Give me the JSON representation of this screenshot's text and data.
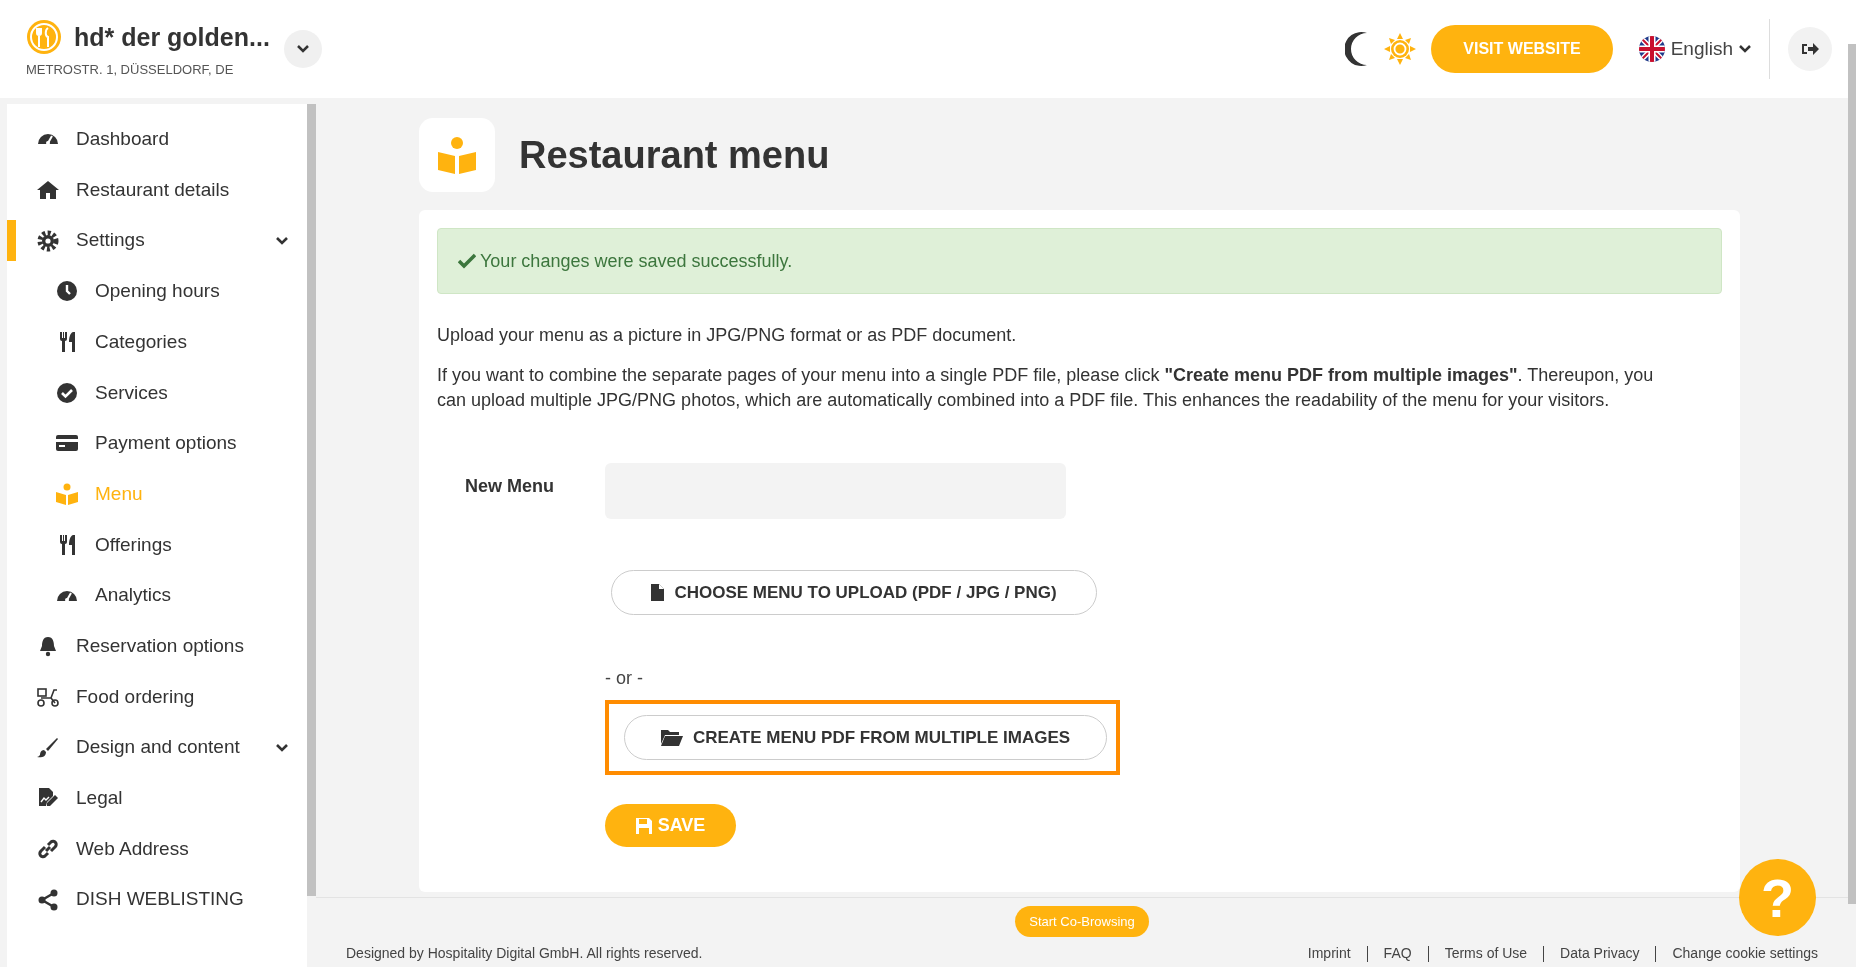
{
  "header": {
    "restaurant_name": "hd* der golden...",
    "address": "METROSTR. 1, DÜSSELDORF, DE",
    "visit_button": "VISIT WEBSITE",
    "language": "English",
    "light_mode": true
  },
  "sidebar": {
    "items": [
      {
        "label": "Dashboard",
        "selected": false
      },
      {
        "label": "Restaurant details",
        "selected": false
      },
      {
        "label": "Settings",
        "selected": false,
        "expanded": true,
        "children": [
          {
            "label": "Opening hours",
            "selected": false
          },
          {
            "label": "Categories",
            "selected": false
          },
          {
            "label": "Services",
            "selected": false
          },
          {
            "label": "Payment options",
            "selected": false
          },
          {
            "label": "Menu",
            "selected": true
          },
          {
            "label": "Offerings",
            "selected": false
          },
          {
            "label": "Analytics",
            "selected": false
          }
        ]
      },
      {
        "label": "Reservation options",
        "selected": false
      },
      {
        "label": "Food ordering",
        "selected": false
      },
      {
        "label": "Design and content",
        "selected": false,
        "expanded": false
      },
      {
        "label": "Legal",
        "selected": false
      },
      {
        "label": "Web Address",
        "selected": false
      },
      {
        "label": "DISH WEBLISTING",
        "selected": false
      }
    ]
  },
  "page": {
    "title": "Restaurant menu",
    "success_message": "Your changes were saved successfully.",
    "intro": "Upload your menu as a picture in JPG/PNG format or as PDF document.",
    "description": "If you want to combine the separate pages of your menu into a single PDF file, please click **\"Create menu PDF from multiple images\"**. Thereupon, you can upload multiple JPG/PNG photos, which are automatically combined into a PDF file. This enhances the readability of the menu for your visitors.",
    "field_label": "New Menu",
    "upload_button": "CHOOSE MENU TO UPLOAD (PDF / JPG / PNG)",
    "or_text": "- or -",
    "create_pdf_button": "CREATE MENU PDF FROM MULTIPLE IMAGES",
    "create_pdf_highlighted": true,
    "save_button": "SAVE"
  },
  "footer": {
    "cobrowse_button": "Start Co-Browsing",
    "copyright": "Designed by Hospitality Digital GmbH. All rights reserved.",
    "help_button": "?",
    "links": [
      "Imprint",
      "FAQ",
      "Terms of Use",
      "Data Privacy",
      "Change cookie settings"
    ]
  }
}
